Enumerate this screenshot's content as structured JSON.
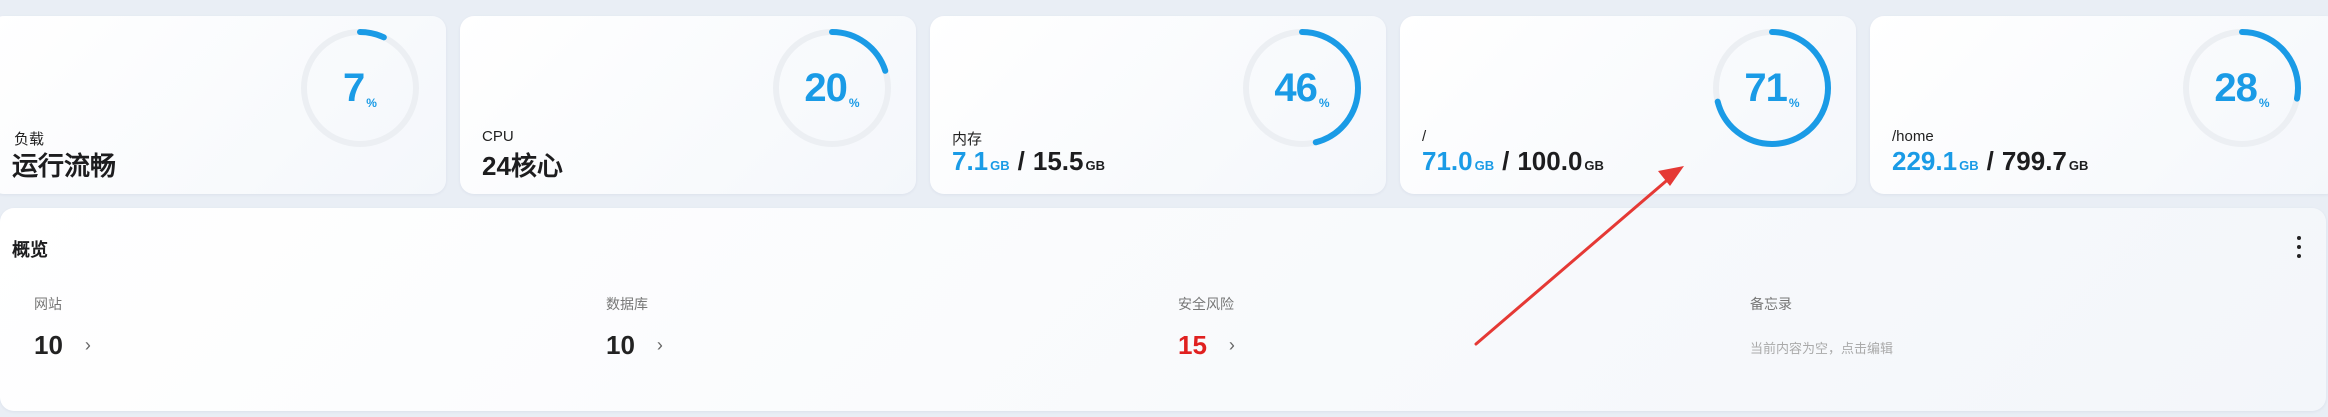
{
  "cards": [
    {
      "label": "负载",
      "main": "运行流畅",
      "percent": 7,
      "unit": "%"
    },
    {
      "label": "CPU",
      "main": "24核心",
      "percent": 20,
      "unit": "%"
    },
    {
      "label": "内存",
      "used": "7.1",
      "used_unit": "GB",
      "sep": "/",
      "total": "15.5",
      "total_unit": "GB",
      "percent": 46,
      "unit": "%"
    },
    {
      "label": "/",
      "used": "71.0",
      "used_unit": "GB",
      "sep": "/",
      "total": "100.0",
      "total_unit": "GB",
      "percent": 71,
      "unit": "%"
    },
    {
      "label": "/home",
      "used": "229.1",
      "used_unit": "GB",
      "sep": "/",
      "total": "799.7",
      "total_unit": "GB",
      "percent": 28,
      "unit": "%"
    }
  ],
  "overview": {
    "title": "概览",
    "items": [
      {
        "label": "网站",
        "value": "10"
      },
      {
        "label": "数据库",
        "value": "10"
      },
      {
        "label": "安全风险",
        "value": "15"
      },
      {
        "label": "备忘录",
        "text": "当前内容为空，点击编辑"
      }
    ]
  },
  "colors": {
    "accent": "#1a9be6",
    "danger": "#e02020",
    "track": "#eceff3",
    "annotation": "#e53935"
  }
}
